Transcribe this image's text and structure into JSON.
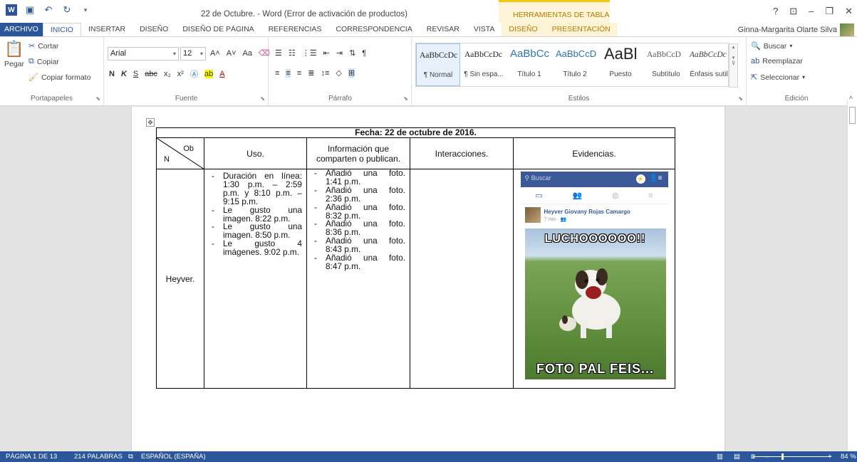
{
  "window": {
    "title": "22 de Octubre. - Word (Error de activación de productos)",
    "table_tools_label": "HERRAMIENTAS DE TABLA",
    "user": "Ginna-Margarita Olarte Silva"
  },
  "tabs": [
    "ARCHIVO",
    "INICIO",
    "INSERTAR",
    "DISEÑO",
    "DISEÑO DE PÁGINA",
    "REFERENCIAS",
    "CORRESPONDENCIA",
    "REVISAR",
    "VISTA",
    "DISEÑO",
    "PRESENTACIÓN"
  ],
  "active_tab": "INICIO",
  "ribbon": {
    "clipboard": {
      "paste": "Pegar",
      "cut": "Cortar",
      "copy": "Copiar",
      "format_painter": "Copiar formato",
      "label": "Portapapeles"
    },
    "font": {
      "family": "Arial",
      "size": "12",
      "change_case": "Aa",
      "label": "Fuente"
    },
    "paragraph": {
      "label": "Párrafo"
    },
    "styles": {
      "label": "Estilos",
      "items": [
        {
          "preview": "AaBbCcDc",
          "name": "¶ Normal"
        },
        {
          "preview": "AaBbCcDc",
          "name": "¶ Sin espa..."
        },
        {
          "preview": "AaBbCc",
          "name": "Título 1"
        },
        {
          "preview": "AaBbCcD",
          "name": "Título 2"
        },
        {
          "preview": "AaBl",
          "name": "Puesto"
        },
        {
          "preview": "AaBbCcD",
          "name": "Subtítulo"
        },
        {
          "preview": "AaBbCcDc",
          "name": "Énfasis sutil"
        }
      ]
    },
    "editing": {
      "find": "Buscar",
      "replace": "Reemplazar",
      "select": "Seleccionar",
      "label": "Edición"
    }
  },
  "document": {
    "date_header": "Fecha: 22 de octubre de 2016.",
    "corner_ob": "Ob",
    "corner_n": "N",
    "columns": [
      "Uso.",
      "Información que comparten o publican.",
      "Interacciones.",
      "Evidencias."
    ],
    "row_name": "Heyver.",
    "uso": [
      "Duración en línea: 1:30 p.m. – 2:59 p.m. y 8:10 p.m. – 9:15 p.m.",
      "Le gusto una imagen. 8:22 p.m.",
      "Le gusto una imagen. 8:50 p.m.",
      "Le gusto 4 imágenes. 9:02 p.m."
    ],
    "info": [
      "Añadió una foto. 1:41 p.m.",
      "Añadió una foto. 2:36 p.m.",
      "Añadió una foto. 8:32 p.m.",
      "Añadió una foto. 8:36 p.m.",
      "Añadió una foto. 8:43 p.m.",
      "Añadió una foto. 8:47 p.m."
    ],
    "evidence": {
      "search_placeholder": "Buscar",
      "poster": "Heyver Giovany Rojas Camargo",
      "time": "7 min · 👥",
      "meme_top": "LUCHOOOOOO!!",
      "meme_bottom": "FOTO PAL FEIS..."
    }
  },
  "status": {
    "page": "PÁGINA 1 DE 13",
    "words": "214 PALABRAS",
    "language": "ESPAÑOL (ESPAÑA)",
    "zoom": "84 %"
  },
  "colors": {
    "word_blue": "#2b579a",
    "table_tools": "#f2c811",
    "facebook": "#3b5998"
  }
}
